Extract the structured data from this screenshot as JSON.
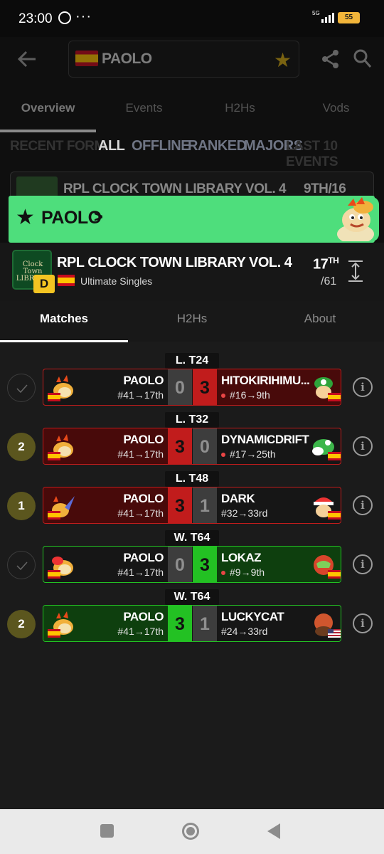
{
  "status_bar": {
    "time": "23:00",
    "dots": "···",
    "network": "5G",
    "battery": "55"
  },
  "search": {
    "name": "PAOLO"
  },
  "top_tabs": [
    "Overview",
    "Events",
    "H2Hs",
    "Vods"
  ],
  "filters": {
    "ghost": "RECENT FORM",
    "ghost2": "LAST 10 EVENTS",
    "items": [
      "ALL",
      "OFFLINE",
      "RANKED",
      "MAJORS"
    ]
  },
  "bg_card": {
    "title": "RPL CLOCK TOWN LIBRARY VOL. 4",
    "rank": "9TH/16"
  },
  "banner": {
    "name": "PAOLO",
    "chevron": ">"
  },
  "event": {
    "logo_text": "Clock Town LIBRARY",
    "tier": "D",
    "title": "RPL CLOCK TOWN LIBRARY VOL. 4",
    "subtitle": "Ultimate Singles",
    "placement": "17",
    "placement_suffix": "TH",
    "entrants": "/61"
  },
  "sub_tabs": [
    "Matches",
    "H2Hs",
    "About"
  ],
  "matches": [
    {
      "round": "L. T24",
      "status": "✓",
      "player": "PAOLO",
      "player_seed": "#41→17th",
      "score_l": "0",
      "score_r": "3",
      "opponent": "HITOKIRIHIMU...",
      "opp_seed": "#16→9th",
      "result": "loss"
    },
    {
      "round": "L. T32",
      "status": "2",
      "player": "PAOLO",
      "player_seed": "#41→17th",
      "score_l": "3",
      "score_r": "0",
      "opponent": "DYNAMICDRIFT",
      "opp_seed": "#17→25th",
      "result": "win-upset"
    },
    {
      "round": "L. T48",
      "status": "1",
      "player": "PAOLO",
      "player_seed": "#41→17th",
      "score_l": "3",
      "score_r": "1",
      "opponent": "DARK",
      "opp_seed": "#32→33rd",
      "result": "win"
    },
    {
      "round": "W. T64",
      "status": "✓",
      "player": "PAOLO",
      "player_seed": "#41→17th",
      "score_l": "0",
      "score_r": "3",
      "opponent": "LOKAZ",
      "opp_seed": "#9→9th",
      "result": "loss"
    },
    {
      "round": "W. T64",
      "status": "2",
      "player": "PAOLO",
      "player_seed": "#41→17th",
      "score_l": "3",
      "score_r": "1",
      "opponent": "LUCKYCAT",
      "opp_seed": "#24→33rd",
      "result": "win"
    }
  ],
  "colors": {
    "green_banner": "#4ede7c",
    "loss_red": "#c11c1c",
    "win_green": "#23c123",
    "tier_yellow": "#f3c422"
  }
}
